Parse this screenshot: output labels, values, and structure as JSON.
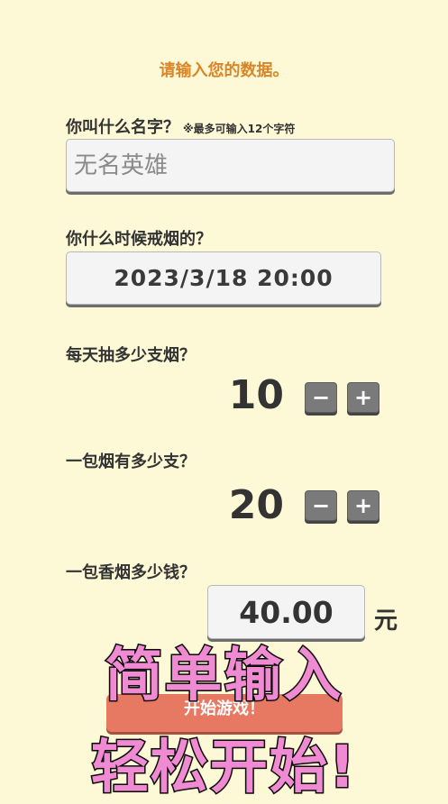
{
  "header": {
    "title": "请输入您的数据。"
  },
  "name": {
    "question": "你叫什么名字？",
    "note": "※最多可输入12个字符",
    "placeholder": "无名英雄"
  },
  "quit_time": {
    "question": "你什么时候戒烟的？",
    "value": "2023/3/18  20:00"
  },
  "daily": {
    "question": "每天抽多少支烟？",
    "value": "10",
    "minus": "−",
    "plus": "+"
  },
  "pack": {
    "question": "一包烟有多少支？",
    "value": "20",
    "minus": "−",
    "plus": "+"
  },
  "price": {
    "question": "一包香烟多少钱？",
    "value": "40.00",
    "unit": "元"
  },
  "start_button": {
    "label": "开始游戏！"
  },
  "overlay": {
    "line1": "简单输入",
    "line2": "轻松开始!"
  }
}
